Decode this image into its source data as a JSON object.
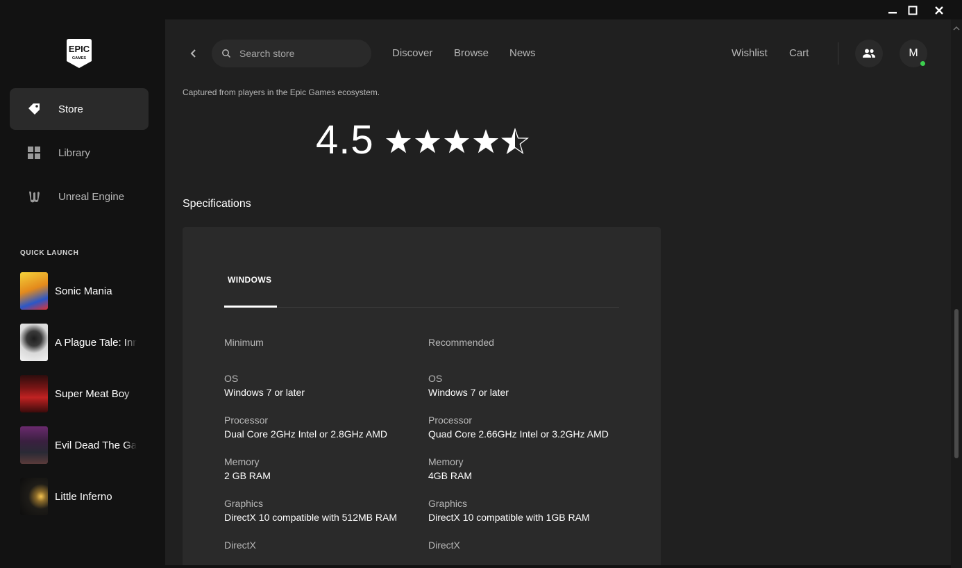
{
  "window": {
    "minimize_icon": "minimize-icon",
    "maximize_icon": "maximize-icon",
    "close_icon": "close-icon"
  },
  "sidebar": {
    "logo_text_top": "EPIC",
    "logo_text_bottom": "GAMES",
    "nav": [
      {
        "label": "Store",
        "icon": "tag-icon",
        "active": true
      },
      {
        "label": "Library",
        "icon": "grid-icon",
        "active": false
      },
      {
        "label": "Unreal Engine",
        "icon": "unreal-icon",
        "active": false
      }
    ],
    "quick_launch_heading": "QUICK LAUNCH",
    "quick_launch": [
      {
        "name": "Sonic Mania",
        "thumb_color": "#e7b52a"
      },
      {
        "name": "A Plague Tale: Innocence",
        "thumb_color": "#cfcfcf"
      },
      {
        "name": "Super Meat Boy",
        "thumb_color": "#9b1f1f"
      },
      {
        "name": "Evil Dead The Game",
        "thumb_color": "#3a2a3e"
      },
      {
        "name": "Little Inferno",
        "thumb_color": "#2a261e"
      }
    ]
  },
  "header": {
    "search_placeholder": "Search store",
    "links": [
      "Discover",
      "Browse",
      "News"
    ],
    "wishlist": "Wishlist",
    "cart": "Cart",
    "avatar_letter": "M"
  },
  "ratings": {
    "caption": "Captured from players in the Epic Games ecosystem.",
    "score": "4.5",
    "stars": 4.5
  },
  "specifications": {
    "heading": "Specifications",
    "tab": "WINDOWS",
    "minimum": {
      "title": "Minimum",
      "rows": [
        {
          "label": "OS",
          "value": "Windows 7 or later"
        },
        {
          "label": "Processor",
          "value": "Dual Core 2GHz Intel or 2.8GHz AMD"
        },
        {
          "label": "Memory",
          "value": "2 GB RAM"
        },
        {
          "label": "Graphics",
          "value": "DirectX 10 compatible with 512MB RAM"
        },
        {
          "label": "DirectX",
          "value": ""
        }
      ]
    },
    "recommended": {
      "title": "Recommended",
      "rows": [
        {
          "label": "OS",
          "value": "Windows 7 or later"
        },
        {
          "label": "Processor",
          "value": "Quad Core 2.66GHz Intel or 3.2GHz AMD"
        },
        {
          "label": "Memory",
          "value": "4GB RAM"
        },
        {
          "label": "Graphics",
          "value": "DirectX 10 compatible with 1GB RAM"
        },
        {
          "label": "DirectX",
          "value": ""
        }
      ]
    }
  }
}
